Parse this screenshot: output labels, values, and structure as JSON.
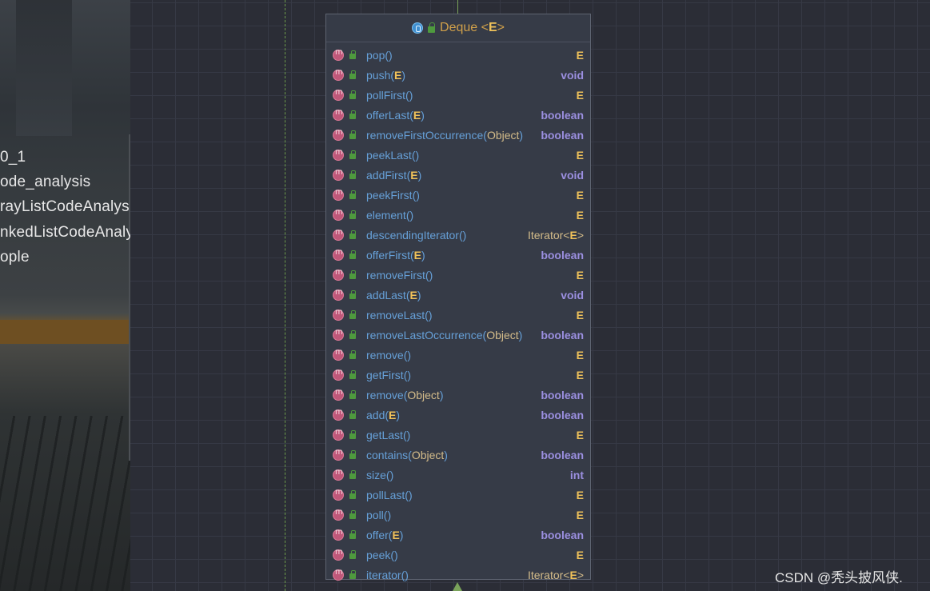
{
  "sidebar": {
    "items": [
      "0_1",
      "ode_analysis",
      "rayListCodeAnalysi",
      "nkedListCodeAnalys",
      "ople"
    ]
  },
  "diagram": {
    "class_name": "Deque",
    "type_param": "E",
    "header_icon": "interface-icon",
    "method_icon": "method-icon",
    "access_icon": "public-lock-icon",
    "colors": {
      "background": "#2b2d36",
      "panel": "#363b47",
      "method_name": "#66a0d8",
      "generic_type": "#f0c25a",
      "primitive_type": "#9b8fe0"
    },
    "methods": [
      {
        "name": "pop",
        "params": "",
        "returns": "E"
      },
      {
        "name": "push",
        "params": "E",
        "returns": "void"
      },
      {
        "name": "pollFirst",
        "params": "",
        "returns": "E"
      },
      {
        "name": "offerLast",
        "params": "E",
        "returns": "boolean"
      },
      {
        "name": "removeFirstOccurrence",
        "params": "Object",
        "returns": "boolean"
      },
      {
        "name": "peekLast",
        "params": "",
        "returns": "E"
      },
      {
        "name": "addFirst",
        "params": "E",
        "returns": "void"
      },
      {
        "name": "peekFirst",
        "params": "",
        "returns": "E"
      },
      {
        "name": "element",
        "params": "",
        "returns": "E"
      },
      {
        "name": "descendingIterator",
        "params": "",
        "returns": "Iterator<E>"
      },
      {
        "name": "offerFirst",
        "params": "E",
        "returns": "boolean"
      },
      {
        "name": "removeFirst",
        "params": "",
        "returns": "E"
      },
      {
        "name": "addLast",
        "params": "E",
        "returns": "void"
      },
      {
        "name": "removeLast",
        "params": "",
        "returns": "E"
      },
      {
        "name": "removeLastOccurrence",
        "params": "Object",
        "returns": "boolean"
      },
      {
        "name": "remove",
        "params": "",
        "returns": "E"
      },
      {
        "name": "getFirst",
        "params": "",
        "returns": "E"
      },
      {
        "name": "remove",
        "params": "Object",
        "returns": "boolean"
      },
      {
        "name": "add",
        "params": "E",
        "returns": "boolean"
      },
      {
        "name": "getLast",
        "params": "",
        "returns": "E"
      },
      {
        "name": "contains",
        "params": "Object",
        "returns": "boolean"
      },
      {
        "name": "size",
        "params": "",
        "returns": "int"
      },
      {
        "name": "pollLast",
        "params": "",
        "returns": "E"
      },
      {
        "name": "poll",
        "params": "",
        "returns": "E"
      },
      {
        "name": "offer",
        "params": "E",
        "returns": "boolean"
      },
      {
        "name": "peek",
        "params": "",
        "returns": "E"
      },
      {
        "name": "iterator",
        "params": "",
        "returns": "Iterator<E>"
      }
    ]
  },
  "watermark": "CSDN @秃头披风侠."
}
